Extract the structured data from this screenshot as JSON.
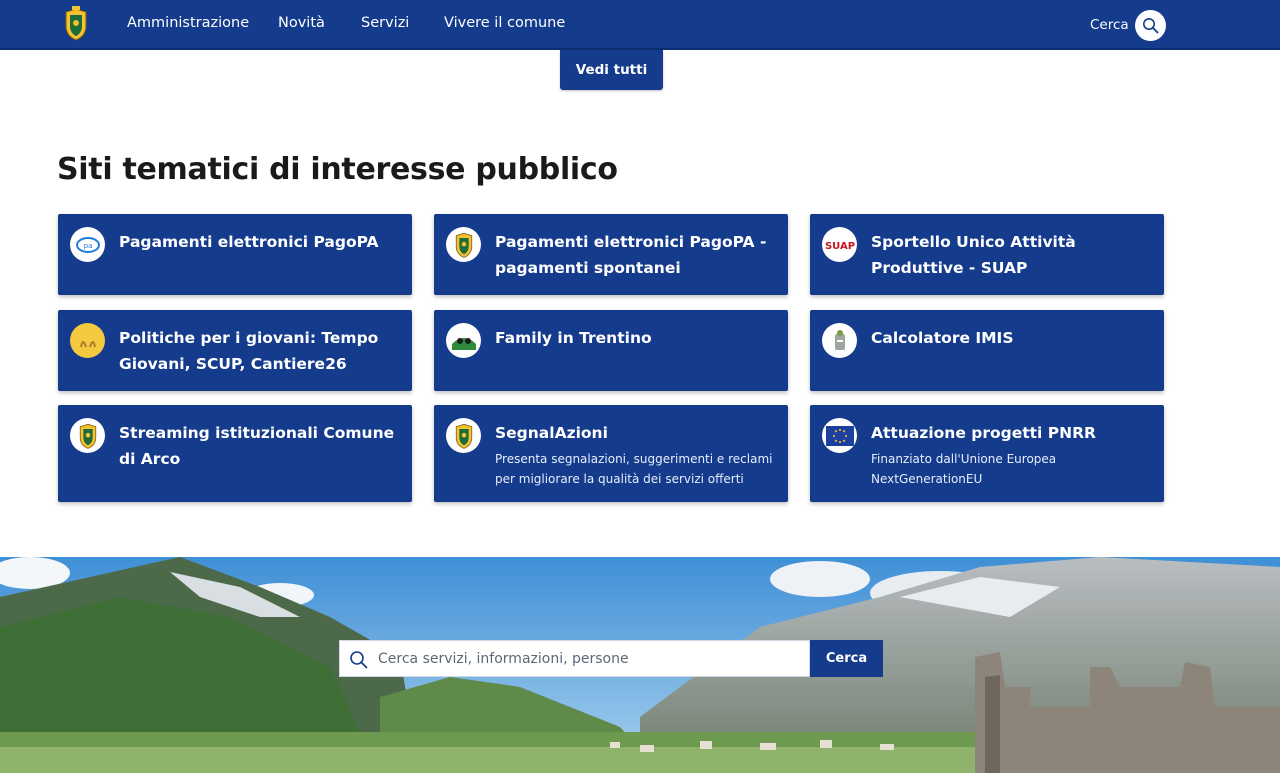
{
  "header": {
    "logo_icon": "municipal-crest-icon",
    "nav": [
      "Amministrazione",
      "Novità",
      "Servizi",
      "Vivere il comune"
    ],
    "search_label": "Cerca",
    "search_icon": "search-icon",
    "color": "#143b8c"
  },
  "top_button": {
    "label": "Vedi tutti"
  },
  "section": {
    "title": "Siti tematici di interesse pubblico",
    "cards": [
      {
        "title": "Pagamenti elettronici PagoPA",
        "subtitle": "",
        "icon": "pagopa-logo-icon"
      },
      {
        "title": "Pagamenti elettronici PagoPA - pagamenti spontanei",
        "subtitle": "",
        "icon": "municipal-crest-icon"
      },
      {
        "title": "Sportello Unico Attività Produttive - SUAP",
        "subtitle": "",
        "icon": "suap-logo-icon"
      },
      {
        "title": "Politiche per i giovani: Tempo Giovani, SCUP, Cantiere26",
        "subtitle": "",
        "icon": "youth-logo-icon"
      },
      {
        "title": "Family in Trentino",
        "subtitle": "",
        "icon": "family-logo-icon"
      },
      {
        "title": "Calcolatore IMIS",
        "subtitle": "",
        "icon": "imis-logo-icon"
      },
      {
        "title": "Streaming istituzionali Comune di Arco",
        "subtitle": "",
        "icon": "municipal-crest-icon"
      },
      {
        "title": "SegnalAzioni",
        "subtitle": "Presenta segnalazioni, suggerimenti e reclami per migliorare la qualità dei servizi offerti",
        "icon": "municipal-crest-icon"
      },
      {
        "title": "Attuazione progetti PNRR",
        "subtitle": "Finanziato dall'Unione Europea NextGenerationEU",
        "icon": "eu-flag-icon"
      }
    ]
  },
  "hero": {
    "search_placeholder": "Cerca servizi, informazioni, persone",
    "search_button": "Cerca"
  }
}
